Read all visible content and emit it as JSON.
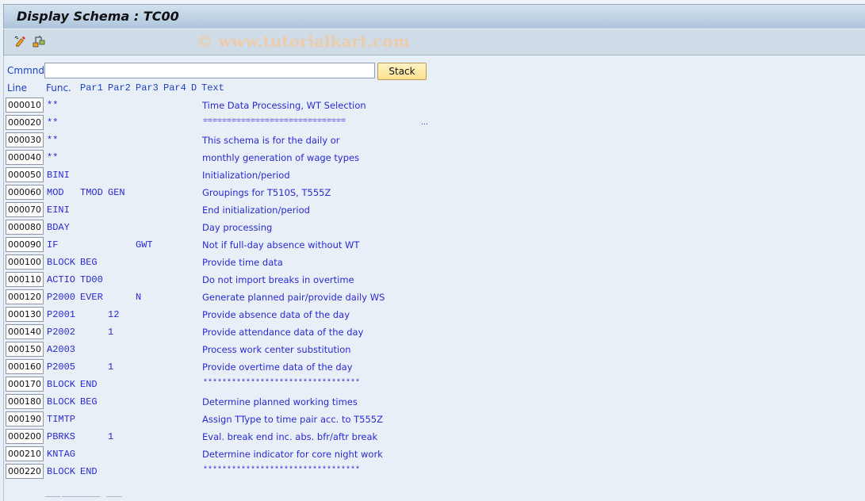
{
  "window": {
    "title": "Display Schema : TC00"
  },
  "toolbar": {
    "icons": [
      {
        "name": "display-change-icon",
        "glyph": "✎"
      },
      {
        "name": "hierarchy-icon",
        "glyph": "⊞"
      }
    ],
    "watermark": "© www.tutorialkart.com"
  },
  "command": {
    "label": "Cmmnd",
    "value": "",
    "placeholder": "",
    "stack_label": "Stack"
  },
  "table": {
    "headers": {
      "line": "Line",
      "func": "Func.",
      "par1": "Par1",
      "par2": "Par2",
      "par3": "Par3",
      "par4": "Par4",
      "d": "D",
      "text": "Text"
    },
    "rows": [
      {
        "line": "000010",
        "func": "**",
        "par1": "",
        "par2": "",
        "par3": "",
        "par4": "",
        "d": "",
        "text": "Time Data Processing, WT Selection"
      },
      {
        "line": "000020",
        "func": "**",
        "par1": "",
        "par2": "",
        "par3": "",
        "par4": "",
        "d": "",
        "text": "==============================",
        "truncated": true
      },
      {
        "line": "000030",
        "func": "**",
        "par1": "",
        "par2": "",
        "par3": "",
        "par4": "",
        "d": "",
        "text": "This schema is for the daily or"
      },
      {
        "line": "000040",
        "func": "**",
        "par1": "",
        "par2": "",
        "par3": "",
        "par4": "",
        "d": "",
        "text": "monthly generation of wage types"
      },
      {
        "line": "000050",
        "func": "BINI",
        "par1": "",
        "par2": "",
        "par3": "",
        "par4": "",
        "d": "",
        "text": "Initialization/period"
      },
      {
        "line": "000060",
        "func": "MOD",
        "par1": "TMOD",
        "par2": "GEN",
        "par3": "",
        "par4": "",
        "d": "",
        "text": "Groupings for T510S, T555Z"
      },
      {
        "line": "000070",
        "func": "EINI",
        "par1": "",
        "par2": "",
        "par3": "",
        "par4": "",
        "d": "",
        "text": "End initialization/period"
      },
      {
        "line": "000080",
        "func": "BDAY",
        "par1": "",
        "par2": "",
        "par3": "",
        "par4": "",
        "d": "",
        "text": "Day processing"
      },
      {
        "line": "000090",
        "func": "IF",
        "par1": "",
        "par2": "",
        "par3": "GWT",
        "par4": "",
        "d": "",
        "text": "Not if full-day absence without WT"
      },
      {
        "line": "000100",
        "func": "BLOCK",
        "par1": "BEG",
        "par2": "",
        "par3": "",
        "par4": "",
        "d": "",
        "text": "Provide time data"
      },
      {
        "line": "000110",
        "func": "ACTIO",
        "par1": "TD00",
        "par2": "",
        "par3": "",
        "par4": "",
        "d": "",
        "text": "Do not import breaks in overtime"
      },
      {
        "line": "000120",
        "func": "P2000",
        "par1": "EVER",
        "par2": "",
        "par3": "N",
        "par4": "",
        "d": "",
        "text": "Generate planned pair/provide daily WS"
      },
      {
        "line": "000130",
        "func": "P2001",
        "par1": "",
        "par2": "12",
        "par3": "",
        "par4": "",
        "d": "",
        "text": "Provide absence data of the day"
      },
      {
        "line": "000140",
        "func": "P2002",
        "par1": "",
        "par2": "1",
        "par3": "",
        "par4": "",
        "d": "",
        "text": "Provide attendance data of the day"
      },
      {
        "line": "000150",
        "func": "A2003",
        "par1": "",
        "par2": "",
        "par3": "",
        "par4": "",
        "d": "",
        "text": "Process work center substitution"
      },
      {
        "line": "000160",
        "func": "P2005",
        "par1": "",
        "par2": "1",
        "par3": "",
        "par4": "",
        "d": "",
        "text": "Provide overtime data of the day"
      },
      {
        "line": "000170",
        "func": "BLOCK",
        "par1": "END",
        "par2": "",
        "par3": "",
        "par4": "",
        "d": "",
        "text": "*********************************"
      },
      {
        "line": "000180",
        "func": "BLOCK",
        "par1": "BEG",
        "par2": "",
        "par3": "",
        "par4": "",
        "d": "",
        "text": "Determine planned working times"
      },
      {
        "line": "000190",
        "func": "TIMTP",
        "par1": "",
        "par2": "",
        "par3": "",
        "par4": "",
        "d": "",
        "text": "Assign TType to time pair acc. to T555Z"
      },
      {
        "line": "000200",
        "func": "PBRKS",
        "par1": "",
        "par2": "1",
        "par3": "",
        "par4": "",
        "d": "",
        "text": "Eval. break end inc. abs. bfr/aftr break"
      },
      {
        "line": "000210",
        "func": "KNTAG",
        "par1": "",
        "par2": "",
        "par3": "",
        "par4": "",
        "d": "",
        "text": "Determine indicator for core night work"
      },
      {
        "line": "000220",
        "func": "BLOCK",
        "par1": "END",
        "par2": "",
        "par3": "",
        "par4": "",
        "d": "",
        "text": "*********************************"
      }
    ]
  }
}
